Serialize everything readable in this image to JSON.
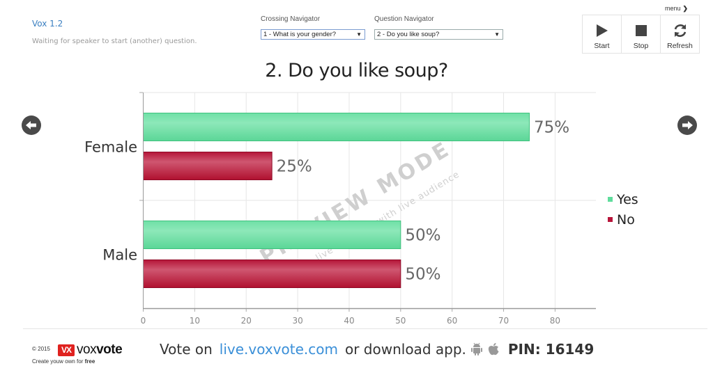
{
  "header": {
    "app_title": "Vox 1.2",
    "status": "Waiting for speaker to start (another) question.",
    "crossing_navigator": {
      "label": "Crossing Navigator",
      "selected": "1 - What is your gender?"
    },
    "question_navigator": {
      "label": "Question Navigator",
      "selected": "2 - Do you like soup?"
    },
    "menu_label": "menu",
    "controls": [
      {
        "label": "Start",
        "icon": "play-icon"
      },
      {
        "label": "Stop",
        "icon": "stop-icon"
      },
      {
        "label": "Refresh",
        "icon": "refresh-icon"
      }
    ]
  },
  "navigation": {
    "prev_icon": "arrow-left-circle-icon",
    "next_icon": "arrow-right-circle-icon"
  },
  "watermark": {
    "main": "PREVIEW MODE",
    "sub": "use live on stage with live audience"
  },
  "chart_data": {
    "type": "bar",
    "orientation": "horizontal",
    "title": "2. Do you like soup?",
    "categories": [
      "Female",
      "Male"
    ],
    "series": [
      {
        "name": "Yes",
        "color": "#5fdc9c",
        "values": [
          75,
          50
        ],
        "labels": [
          "75%",
          "50%"
        ]
      },
      {
        "name": "No",
        "color": "#b8153a",
        "values": [
          25,
          50
        ],
        "labels": [
          "25%",
          "50%"
        ]
      }
    ],
    "xlabel": "",
    "ylabel": "",
    "xlim": [
      0,
      88
    ],
    "x_ticks": [
      0,
      10,
      20,
      30,
      40,
      50,
      60,
      70,
      80
    ],
    "grid": true,
    "legend": "right"
  },
  "footer": {
    "copyright": "© 2015",
    "logo_mark": "VX",
    "logo_text_light": "vox",
    "logo_text_bold": "vote",
    "tagline_prefix": "Create youw own for ",
    "tagline_bold": "free",
    "vote_prefix": "Vote on",
    "vote_link": "live.voxvote.com",
    "vote_suffix": "or download app.",
    "android_icon": "android-icon",
    "apple_icon": "apple-icon",
    "pin": "PIN: 16149"
  }
}
